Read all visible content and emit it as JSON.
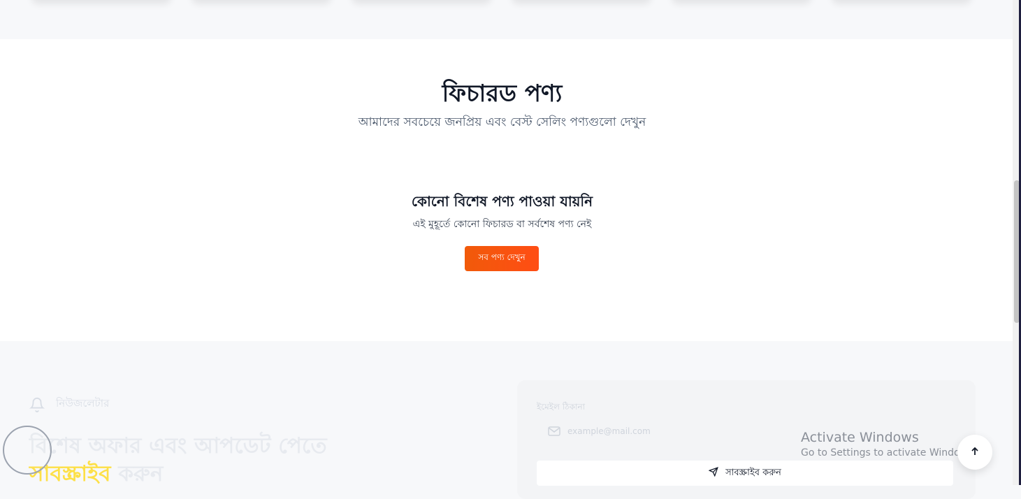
{
  "featured": {
    "title": "ফিচারড পণ্য",
    "subtitle": "আমাদের সবচেয়ে জনপ্রিয় এবং বেস্ট সেলিং পণ্যগুলো দেখুন",
    "empty_title": "কোনো বিশেষ পণ্য পাওয়া যায়নি",
    "empty_text": "এই মুহূর্তে কোনো ফিচারড বা সর্বশেষ পণ্য নেই",
    "view_all_label": "সব পণ্য দেখুন"
  },
  "newsletter": {
    "badge_label": "নিউজলেটার",
    "heading_part1": "বিশেষ অফার এবং আপডেট পেতে",
    "heading_highlight": "সাবস্ক্রাইব",
    "heading_part2": "করুন",
    "form_label": "ইমেইল ঠিকানা",
    "email_text": "example@mail.com",
    "subscribe_label": "সাবস্ক্রাইব করুন"
  },
  "os_overlay": {
    "activate_title": "Activate Windows",
    "activate_sub": "Go to Settings to activate Windows."
  },
  "colors": {
    "accent": "#f15a0a",
    "highlight": "#fde047"
  },
  "icons": [
    "bell-icon",
    "mail-icon",
    "send-icon",
    "arrow-up-icon"
  ]
}
